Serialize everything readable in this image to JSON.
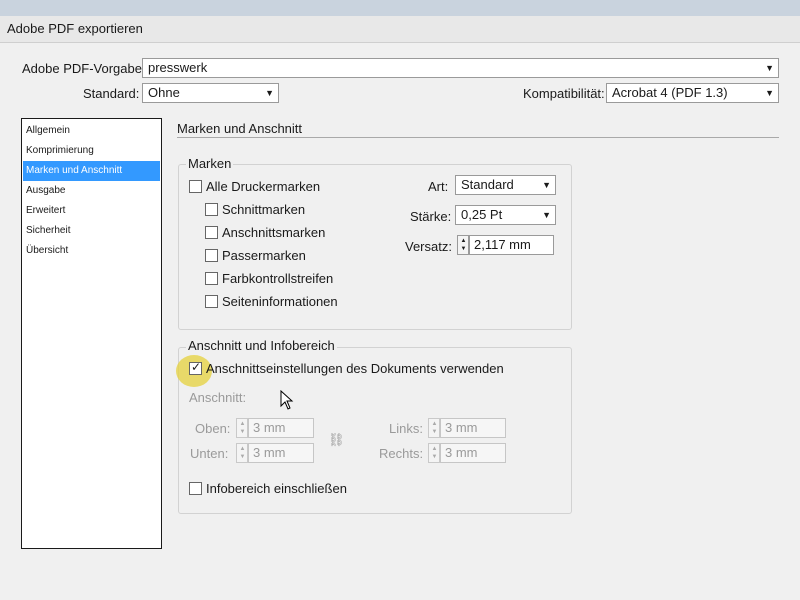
{
  "window": {
    "title": "Adobe PDF exportieren"
  },
  "header": {
    "preset_label": "Adobe PDF-Vorgabe:",
    "preset_value": "presswerk",
    "standard_label": "Standard:",
    "standard_value": "Ohne",
    "compat_label": "Kompatibilität:",
    "compat_value": "Acrobat 4 (PDF 1.3)"
  },
  "sidebar": {
    "items": [
      {
        "label": "Allgemein"
      },
      {
        "label": "Komprimierung"
      },
      {
        "label": "Marken und Anschnitt"
      },
      {
        "label": "Ausgabe"
      },
      {
        "label": "Erweitert"
      },
      {
        "label": "Sicherheit"
      },
      {
        "label": "Übersicht"
      }
    ],
    "selected_index": 2
  },
  "section": {
    "title": "Marken und Anschnitt"
  },
  "marks": {
    "group_title": "Marken",
    "all_label": "Alle Druckermarken",
    "options": [
      {
        "label": "Schnittmarken"
      },
      {
        "label": "Anschnittsmarken"
      },
      {
        "label": "Passermarken"
      },
      {
        "label": "Farbkontrollstreifen"
      },
      {
        "label": "Seiteninformationen"
      }
    ],
    "art_label": "Art:",
    "art_value": "Standard",
    "staerke_label": "Stärke:",
    "staerke_value": "0,25 Pt",
    "versatz_label": "Versatz:",
    "versatz_value": "2,117 mm"
  },
  "bleed": {
    "group_title": "Anschnitt und Infobereich",
    "use_doc_label": "Anschnittseinstellungen des Dokuments verwenden",
    "use_doc_checked": true,
    "anschnitt_label": "Anschnitt:",
    "oben_label": "Oben:",
    "oben_value": "3 mm",
    "unten_label": "Unten:",
    "unten_value": "3 mm",
    "links_label": "Links:",
    "links_value": "3 mm",
    "rechts_label": "Rechts:",
    "rechts_value": "3 mm",
    "info_label": "Infobereich einschließen"
  },
  "icons": {
    "checkmark": "✓",
    "chevron": "▼",
    "up": "▲",
    "down": "▼",
    "link": "⛓"
  },
  "colors": {
    "selection": "#3399ff",
    "highlight": "#e6d23c"
  }
}
